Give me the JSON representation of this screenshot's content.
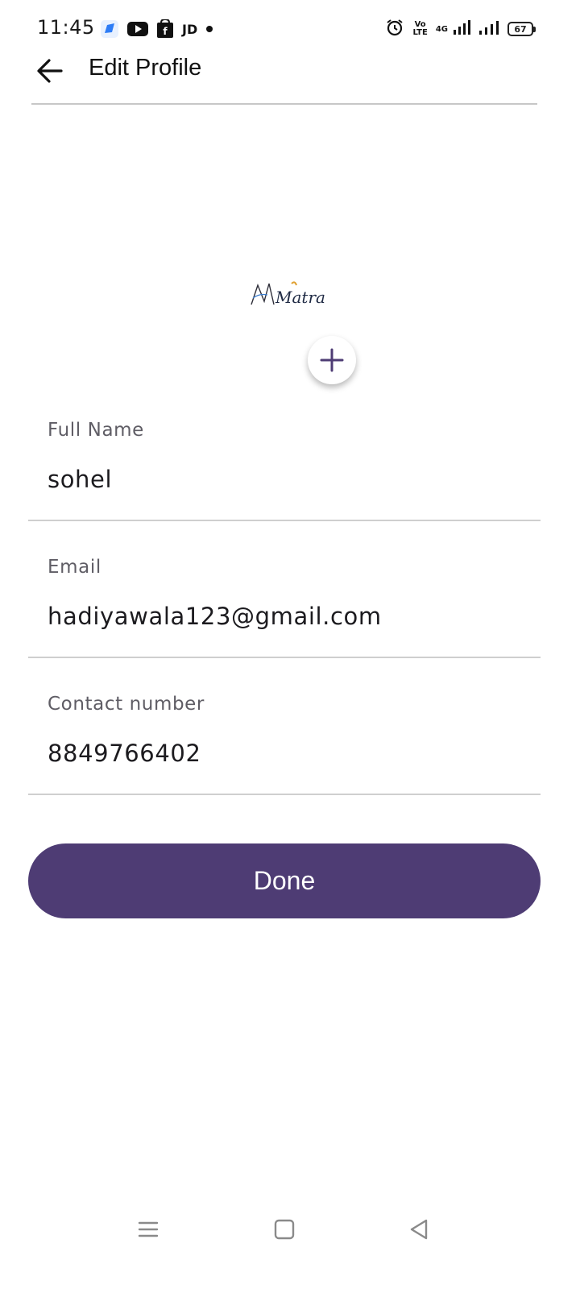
{
  "status_bar": {
    "time": "11:45",
    "notification_icons": [
      "app-icon",
      "youtube-icon",
      "shopping-bag-icon",
      "jd-icon",
      "dot-icon"
    ],
    "jd_label": "JD",
    "volte_line1": "Vo",
    "volte_line2": "LTE",
    "network_label": "4G",
    "battery_level": "67"
  },
  "header": {
    "title": "Edit Profile",
    "back_icon": "arrow-back-icon"
  },
  "profile": {
    "logo_text": "Matra",
    "add_icon": "plus-icon"
  },
  "form": {
    "full_name": {
      "label": "Full Name",
      "value": "sohel"
    },
    "email": {
      "label": "Email",
      "value": "hadiyawala123@gmail.com"
    },
    "contact": {
      "label": "Contact number",
      "value": "8849766402"
    }
  },
  "done_button": {
    "label": "Done"
  },
  "colors": {
    "primary": "#4e3c74",
    "label_text": "#5f5d65",
    "divider": "#cfcfcf"
  },
  "nav_bar": {
    "items": [
      "menu-icon",
      "home-square-icon",
      "back-triangle-icon"
    ]
  }
}
